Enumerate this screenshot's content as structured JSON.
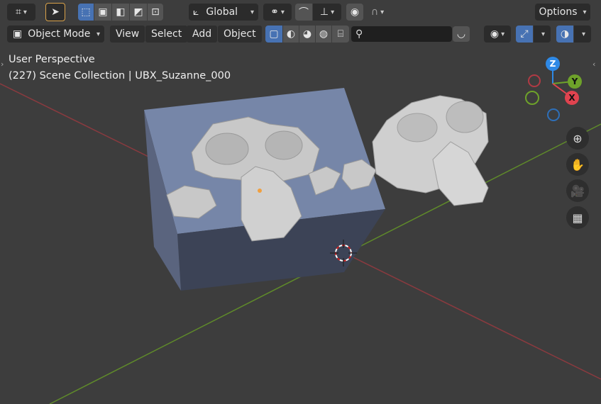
{
  "header": {
    "transform_orientation": "Global",
    "options_label": "Options",
    "mode_label": "Object Mode",
    "menus": [
      "View",
      "Select",
      "Add",
      "Object"
    ],
    "search_placeholder": ""
  },
  "overlay": {
    "perspective_label": "User Perspective",
    "collection_label": "(227) Scene Collection | UBX_Suzanne_000"
  },
  "gizmo": {
    "z_label": "Z",
    "y_label": "Y",
    "x_label": "X",
    "colors": {
      "x": "#e0434f",
      "y": "#6ea22a",
      "z": "#2e89e6"
    }
  },
  "icons": [
    "editor-type-icon",
    "select-cursor-icon",
    "box-select-icon",
    "transform-orientation-icon",
    "snap-icon",
    "proportional-edit-icon",
    "falloff-icon",
    "object-mode-icon",
    "wireframe-icon",
    "solid-icon",
    "material-icon",
    "rendered-icon",
    "brush-icon",
    "search-icon",
    "visibility-icon",
    "gizmo-icon",
    "overlay-icon",
    "zoom-icon",
    "hand-icon",
    "camera-icon",
    "grid-icon"
  ]
}
